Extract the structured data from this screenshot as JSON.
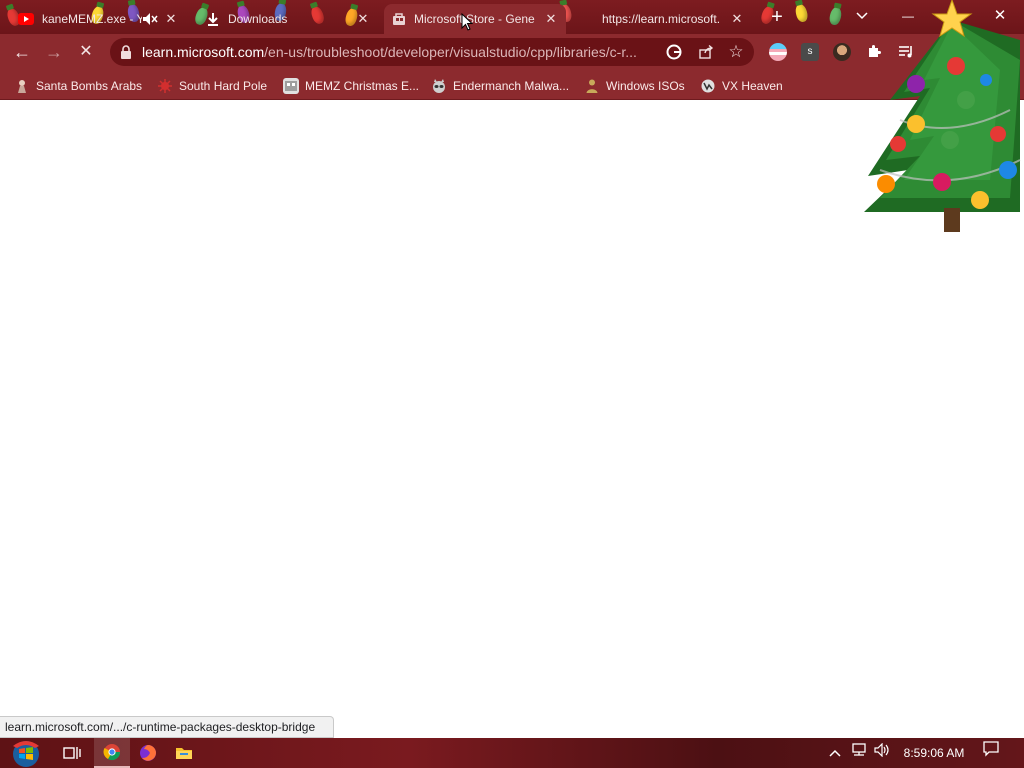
{
  "tabs": [
    {
      "label": "kaneMEMZ.exe - Y",
      "icon": "youtube-icon",
      "audio": "mute-icon"
    },
    {
      "label": "Downloads",
      "icon": "download-icon"
    },
    {
      "label": "Microsoft Store - Gene",
      "icon": "store-icon"
    },
    {
      "label": "https://learn.microsoft.",
      "icon": "loading-icon"
    }
  ],
  "tab_controls": {
    "new_tab": "+",
    "tab_search": "⌄"
  },
  "window": {
    "minimize": "—",
    "close": "✕"
  },
  "toolbar": {
    "back": "←",
    "forward": "→",
    "reload": "✕",
    "url_host": "learn.microsoft.com",
    "url_path": "/en-us/troubleshoot/developer/visualstudio/cpp/libraries/c-r..."
  },
  "extensions": {
    "google": "G",
    "share": "⇪",
    "bookmark": "☆",
    "s_ext": "s",
    "menu": "⋮"
  },
  "bookmarks": [
    {
      "label": "Santa Bombs Arabs",
      "icon": "santa-icon"
    },
    {
      "label": "South Hard Pole",
      "icon": "virus-icon"
    },
    {
      "label": "MEMZ Christmas E...",
      "icon": "memz-icon"
    },
    {
      "label": "Endermanch Malwa...",
      "icon": "raccoon-icon"
    },
    {
      "label": "Windows ISOs",
      "icon": "person-icon"
    },
    {
      "label": "VX Heaven",
      "icon": "vx-icon"
    }
  ],
  "status_url": "learn.microsoft.com/.../c-runtime-packages-desktop-bridge",
  "taskbar": {
    "clock": "8:59:06 AM"
  },
  "colors": {
    "frame": "#8c2a2e",
    "tabstrip": "#7d1c20",
    "taskbar": "#6a1519"
  }
}
